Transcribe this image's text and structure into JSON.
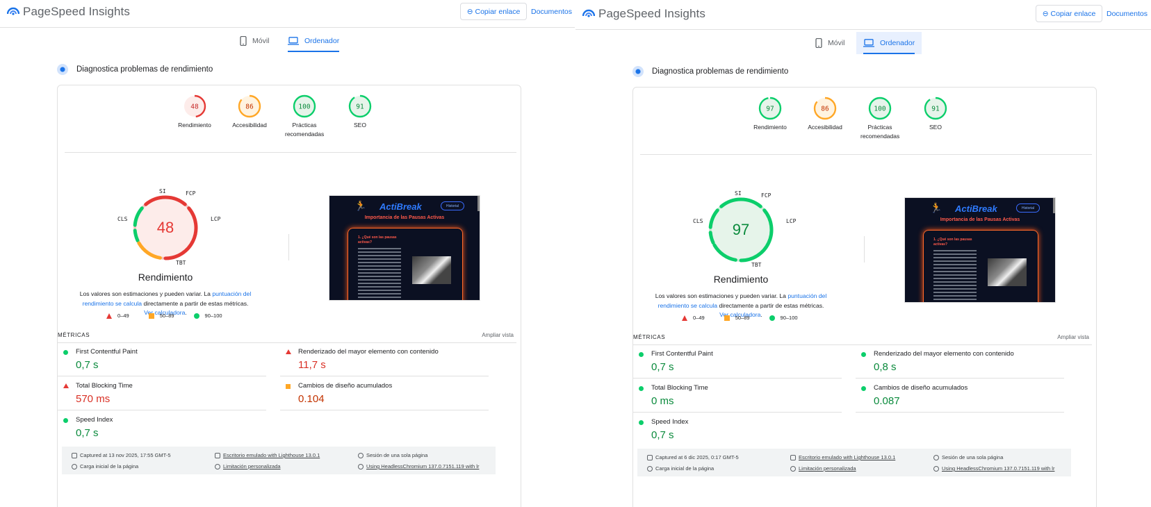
{
  "reports": [
    {
      "header": {
        "app_title": "PageSpeed Insights",
        "copy_link": "Copiar enlace",
        "docs": "Documentos"
      },
      "tabs": {
        "mobile": "Móvil",
        "desktop": "Ordenador"
      },
      "diagnostic_title": "Diagnostica problemas de rendimiento",
      "scores": [
        {
          "value": "48",
          "label": "Rendimiento",
          "level": 0.48,
          "color": "#e53935",
          "bg": "#fdecea",
          "text": "#c62828"
        },
        {
          "value": "86",
          "label": "Accesibilidad",
          "level": 0.86,
          "color": "#ffa726",
          "bg": "#fff3e0",
          "text": "#c33300"
        },
        {
          "value": "100",
          "label": "Prácticas recomendadas",
          "level": 1.0,
          "color": "#0cce6b",
          "bg": "#e6f4ea",
          "text": "#0a8a3c"
        },
        {
          "value": "91",
          "label": "SEO",
          "level": 0.91,
          "color": "#0cce6b",
          "bg": "#e6f4ea",
          "text": "#0a8a3c"
        }
      ],
      "big_score": {
        "value": "48",
        "title": "Rendimiento",
        "color": "#e53935",
        "bg": "#fdecea",
        "text": "#e53935",
        "segments": {
          "FCP": "#0cce6b",
          "LCP": "#e53935",
          "TBT": "#e53935",
          "CLS": "#ffa726",
          "SI": "#0cce6b"
        },
        "labels": {
          "si": "SI",
          "fcp": "FCP",
          "lcp": "LCP",
          "tbt": "TBT",
          "cls": "CLS"
        }
      },
      "note": {
        "text1": "Los valores son estimaciones y pueden variar. La ",
        "link1": "puntuación del rendimiento se calcula",
        "text2": " directamente a partir de estas métricas. ",
        "link2": "Ver calculadora",
        "text3": "."
      },
      "screenshot": {
        "brand": "ActiBreak",
        "menu": "Historial",
        "subtitle": "Importancia de las Pausas Activas",
        "question": "1. ¿Qué son las pausas activas?"
      },
      "legend": {
        "bad": "0–49",
        "avg": "50–89",
        "good": "90–100"
      },
      "metrics_header": {
        "title": "MÉTRICAS",
        "expand": "Ampliar vista"
      },
      "metrics": [
        {
          "name": "First Contentful Paint",
          "value": "0,7 s",
          "status": "good"
        },
        {
          "name": "Renderizado del mayor elemento con contenido",
          "value": "11,7 s",
          "status": "bad"
        },
        {
          "name": "Total Blocking Time",
          "value": "570 ms",
          "status": "bad"
        },
        {
          "name": "Cambios de diseño acumulados",
          "value": "0.104",
          "status": "avg"
        },
        {
          "name": "Speed Index",
          "value": "0,7 s",
          "status": "good"
        }
      ],
      "footer": {
        "captured": "Captured at 13 nov 2025, 17:55 GMT-5",
        "emulated": "Escritorio emulado with Lighthouse 13.0.1",
        "session": "Sesión de una sola página",
        "load": "Carga inicial de la página",
        "throttle": "Limitación personalizada",
        "browser": "Using HeadlessChromium 137.0.7151.119 with lr"
      }
    },
    {
      "header": {
        "app_title": "PageSpeed Insights",
        "copy_link": "Copiar enlace",
        "docs": "Documentos"
      },
      "tabs": {
        "mobile": "Móvil",
        "desktop": "Ordenador"
      },
      "diagnostic_title": "Diagnostica problemas de rendimiento",
      "scores": [
        {
          "value": "97",
          "label": "Rendimiento",
          "level": 0.97,
          "color": "#0cce6b",
          "bg": "#e6f4ea",
          "text": "#0a8a3c"
        },
        {
          "value": "86",
          "label": "Accesibilidad",
          "level": 0.86,
          "color": "#ffa726",
          "bg": "#fff3e0",
          "text": "#c33300"
        },
        {
          "value": "100",
          "label": "Prácticas recomendadas",
          "level": 1.0,
          "color": "#0cce6b",
          "bg": "#e6f4ea",
          "text": "#0a8a3c"
        },
        {
          "value": "91",
          "label": "SEO",
          "level": 0.91,
          "color": "#0cce6b",
          "bg": "#e6f4ea",
          "text": "#0a8a3c"
        }
      ],
      "big_score": {
        "value": "97",
        "title": "Rendimiento",
        "color": "#0cce6b",
        "bg": "#e6f4ea",
        "text": "#0a8a3c",
        "segments": {
          "FCP": "#0cce6b",
          "LCP": "#0cce6b",
          "TBT": "#0cce6b",
          "CLS": "#0cce6b",
          "SI": "#0cce6b"
        },
        "labels": {
          "si": "SI",
          "fcp": "FCP",
          "lcp": "LCP",
          "tbt": "TBT",
          "cls": "CLS"
        }
      },
      "note": {
        "text1": "Los valores son estimaciones y pueden variar. La ",
        "link1": "puntuación del rendimiento se calcula",
        "text2": " directamente a partir de estas métricas. ",
        "link2": "Ver calculadora",
        "text3": "."
      },
      "screenshot": {
        "brand": "ActiBreak",
        "menu": "Historial",
        "subtitle": "Importancia de las Pausas Activas",
        "question": "1. ¿Qué son las pausas activas?"
      },
      "legend": {
        "bad": "0–49",
        "avg": "50–89",
        "good": "90–100"
      },
      "metrics_header": {
        "title": "MÉTRICAS",
        "expand": "Ampliar vista"
      },
      "metrics": [
        {
          "name": "First Contentful Paint",
          "value": "0,7 s",
          "status": "good"
        },
        {
          "name": "Renderizado del mayor elemento con contenido",
          "value": "0,8 s",
          "status": "good"
        },
        {
          "name": "Total Blocking Time",
          "value": "0 ms",
          "status": "good"
        },
        {
          "name": "Cambios de diseño acumulados",
          "value": "0.087",
          "status": "good"
        },
        {
          "name": "Speed Index",
          "value": "0,7 s",
          "status": "good"
        }
      ],
      "footer": {
        "captured": "Captured at 6 dic 2025, 0:17 GMT-5",
        "emulated": "Escritorio emulado with Lighthouse 13.0.1",
        "session": "Sesión de una sola página",
        "load": "Carga inicial de la página",
        "throttle": "Limitación personalizada",
        "browser": "Using HeadlessChromium 137.0.7151.119 with lr"
      }
    }
  ]
}
